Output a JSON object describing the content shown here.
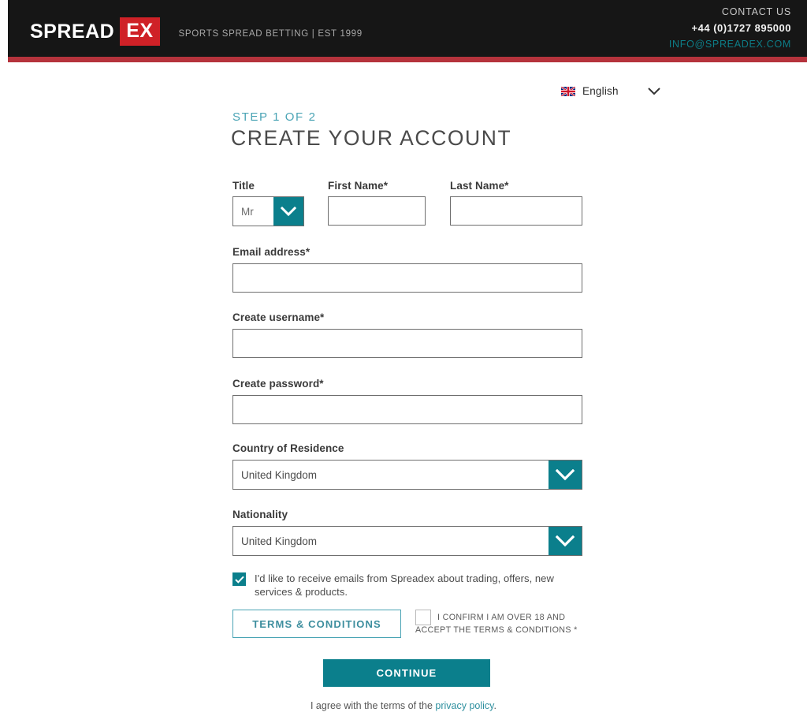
{
  "header": {
    "logo_primary": "SPREAD",
    "logo_accent": "EX",
    "tagline": "SPORTS SPREAD BETTING | EST 1999",
    "contact_us": "CONTACT US",
    "phone": "+44 (0)1727 895000",
    "email": "INFO@SPREADEX.COM",
    "bg_color": "#161616",
    "accent_red": "#cf2127",
    "stripe_color": "#b5333c",
    "email_color": "#0d7d87"
  },
  "language": {
    "label": "English",
    "flag_icon": "uk-flag-icon",
    "chevron_icon": "chevron-down-icon"
  },
  "form": {
    "step": "STEP 1 OF 2",
    "title": "CREATE YOUR ACCOUNT",
    "step_color": "#4aa4b5",
    "accent_teal": "#0b7f8c",
    "labels": {
      "title": "Title",
      "first_name": "First Name*",
      "last_name": "Last Name*",
      "email": "Email address*",
      "username": "Create username*",
      "password": "Create password*",
      "country": "Country of Residence",
      "nationality": "Nationality"
    },
    "values": {
      "title": "Mr",
      "first_name": "",
      "last_name": "",
      "email": "",
      "username": "",
      "password": "",
      "country": "United Kingdom",
      "nationality": "United Kingdom"
    },
    "placeholders": {
      "first_name": "",
      "last_name": "",
      "email": "",
      "username": "",
      "password": ""
    },
    "marketing_checkbox": {
      "checked": true,
      "text": "I'd like to receive emails from Spreadex about trading, offers, new services & products."
    },
    "terms_button": "TERMS & CONDITIONS",
    "confirm_checkbox": {
      "checked": false,
      "text": "I CONFIRM I AM OVER 18 AND ACCEPT THE TERMS & CONDITIONS *"
    },
    "continue_button": "CONTINUE",
    "privacy_prefix": "I agree with the terms of the ",
    "privacy_link": "privacy policy",
    "privacy_suffix": "."
  }
}
